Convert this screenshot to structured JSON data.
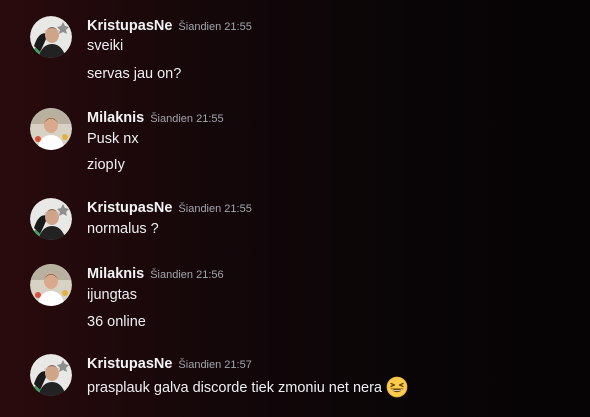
{
  "colors": {
    "username": "#f2f3f5",
    "timestamp": "#a3a6ad",
    "message": "#eef0f3",
    "online_status": "#3ba55c"
  },
  "messages": [
    {
      "author": "KristupasNe",
      "time": "Šiandien 21:55",
      "avatar": "avatar-kristupas",
      "lines": [
        "sveiki",
        "servas jau on?"
      ]
    },
    {
      "author": "Milaknis",
      "time": "Šiandien 21:55",
      "avatar": "avatar-milaknis",
      "lines": [
        "Pusk nx",
        "ziopIy"
      ]
    },
    {
      "author": "KristupasNe",
      "time": "Šiandien 21:55",
      "avatar": "avatar-kristupas",
      "lines": [
        "normalus  ?"
      ]
    },
    {
      "author": "Milaknis",
      "time": "Šiandien 21:56",
      "avatar": "avatar-milaknis",
      "lines": [
        "ijungtas",
        "36 online"
      ]
    },
    {
      "author": "KristupasNe",
      "time": "Šiandien 21:57",
      "avatar": "avatar-kristupas",
      "lines": [
        "prasplauk galva discorde tiek zmoniu net nera"
      ],
      "emoji": "grinning-squinting-face-emoji"
    }
  ]
}
